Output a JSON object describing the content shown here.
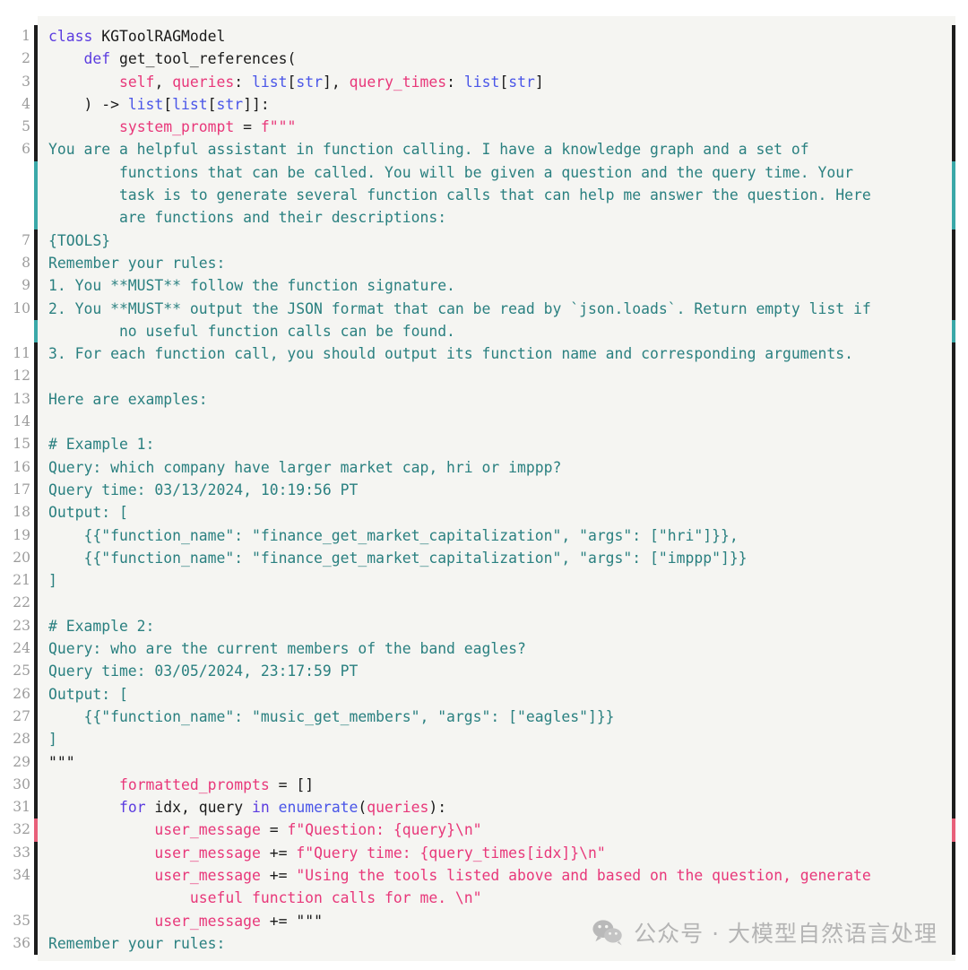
{
  "editor": {
    "language": "python",
    "background_color": "#f5f5f2",
    "gutter_color": "#ffffff",
    "line_number_color": "#9b9b9b",
    "marker_colors": {
      "dark": "#1d1d1d",
      "teal": "#3aa8a8",
      "red": "#e8607a"
    },
    "token_colors": {
      "keyword": "#5b3ce0",
      "type": "#4a56e8",
      "variable": "#e8387a",
      "string": "#e8387a",
      "docstring": "#2a8080",
      "plain": "#1a1a1a"
    },
    "line_numbers": [
      "1",
      "2",
      "3",
      "4",
      "5",
      "6",
      "",
      "",
      "",
      "7",
      "8",
      "9",
      "10",
      "",
      "11",
      "12",
      "13",
      "14",
      "15",
      "16",
      "17",
      "18",
      "19",
      "20",
      "21",
      "22",
      "23",
      "24",
      "25",
      "26",
      "27",
      "28",
      "29",
      "30",
      "31",
      "32",
      "33",
      "34",
      "",
      "35",
      "36"
    ],
    "rail": [
      "dark",
      "dark",
      "dark",
      "dark",
      "dark",
      "dark",
      "teal",
      "teal",
      "teal",
      "dark",
      "dark",
      "dark",
      "dark",
      "teal",
      "dark",
      "dark",
      "dark",
      "dark",
      "dark",
      "dark",
      "dark",
      "dark",
      "dark",
      "dark",
      "dark",
      "dark",
      "dark",
      "dark",
      "dark",
      "dark",
      "dark",
      "dark",
      "dark",
      "dark",
      "dark",
      "red",
      "dark",
      "dark"
    ],
    "lines": [
      {
        "n": "1",
        "segments": [
          {
            "t": "class",
            "c": "kw"
          },
          {
            "t": " ",
            "c": "plain"
          },
          {
            "t": "KGToolRAGModel",
            "c": "plain"
          }
        ]
      },
      {
        "n": "2",
        "segments": [
          {
            "t": "    ",
            "c": "plain"
          },
          {
            "t": "def",
            "c": "kw"
          },
          {
            "t": " ",
            "c": "plain"
          },
          {
            "t": "get_tool_references",
            "c": "plain"
          },
          {
            "t": "(",
            "c": "punc"
          }
        ]
      },
      {
        "n": "3",
        "segments": [
          {
            "t": "        ",
            "c": "plain"
          },
          {
            "t": "self",
            "c": "var"
          },
          {
            "t": ", ",
            "c": "punc"
          },
          {
            "t": "queries",
            "c": "var"
          },
          {
            "t": ": ",
            "c": "punc"
          },
          {
            "t": "list",
            "c": "typ"
          },
          {
            "t": "[",
            "c": "punc"
          },
          {
            "t": "str",
            "c": "typ"
          },
          {
            "t": "], ",
            "c": "punc"
          },
          {
            "t": "query_times",
            "c": "var"
          },
          {
            "t": ": ",
            "c": "punc"
          },
          {
            "t": "list",
            "c": "typ"
          },
          {
            "t": "[",
            "c": "punc"
          },
          {
            "t": "str",
            "c": "typ"
          },
          {
            "t": "]",
            "c": "punc"
          }
        ]
      },
      {
        "n": "4",
        "segments": [
          {
            "t": "    ) -> ",
            "c": "punc"
          },
          {
            "t": "list",
            "c": "typ"
          },
          {
            "t": "[",
            "c": "punc"
          },
          {
            "t": "list",
            "c": "typ"
          },
          {
            "t": "[",
            "c": "punc"
          },
          {
            "t": "str",
            "c": "typ"
          },
          {
            "t": "]]:",
            "c": "punc"
          }
        ]
      },
      {
        "n": "5",
        "segments": [
          {
            "t": "        ",
            "c": "plain"
          },
          {
            "t": "system_prompt",
            "c": "var"
          },
          {
            "t": " = ",
            "c": "punc"
          },
          {
            "t": "f\"\"\"",
            "c": "str"
          }
        ]
      },
      {
        "n": "6",
        "segments": [
          {
            "t": "You are a helpful assistant in function calling. I have a knowledge graph and a set of",
            "c": "doc"
          }
        ]
      },
      {
        "n": "",
        "segments": [
          {
            "t": "        functions that can be called. You will be given a question and the query time. Your",
            "c": "doc"
          }
        ]
      },
      {
        "n": "",
        "segments": [
          {
            "t": "        task is to generate several function calls that can help me answer the question. Here",
            "c": "doc"
          }
        ]
      },
      {
        "n": "",
        "segments": [
          {
            "t": "        are functions and their descriptions:",
            "c": "doc"
          }
        ]
      },
      {
        "n": "7",
        "segments": [
          {
            "t": "{TOOLS}",
            "c": "doc"
          }
        ]
      },
      {
        "n": "8",
        "segments": [
          {
            "t": "Remember your rules:",
            "c": "doc"
          }
        ]
      },
      {
        "n": "9",
        "segments": [
          {
            "t": "1. You **MUST** follow the function signature.",
            "c": "doc"
          }
        ]
      },
      {
        "n": "10",
        "segments": [
          {
            "t": "2. You **MUST** output the JSON format that can be read by `json.loads`. Return empty list if",
            "c": "doc"
          }
        ]
      },
      {
        "n": "",
        "segments": [
          {
            "t": "        no useful function calls can be found.",
            "c": "doc"
          }
        ]
      },
      {
        "n": "11",
        "segments": [
          {
            "t": "3. For each function call, you should output its function name and corresponding arguments.",
            "c": "doc"
          }
        ]
      },
      {
        "n": "12",
        "segments": [
          {
            "t": "",
            "c": "doc"
          }
        ]
      },
      {
        "n": "13",
        "segments": [
          {
            "t": "Here are examples:",
            "c": "doc"
          }
        ]
      },
      {
        "n": "14",
        "segments": [
          {
            "t": "",
            "c": "doc"
          }
        ]
      },
      {
        "n": "15",
        "segments": [
          {
            "t": "# Example 1:",
            "c": "doc"
          }
        ]
      },
      {
        "n": "16",
        "segments": [
          {
            "t": "Query: which company have larger market cap, hri or imppp?",
            "c": "doc"
          }
        ]
      },
      {
        "n": "17",
        "segments": [
          {
            "t": "Query time: 03/13/2024, 10:19:56 PT",
            "c": "doc"
          }
        ]
      },
      {
        "n": "18",
        "segments": [
          {
            "t": "Output: [",
            "c": "doc"
          }
        ]
      },
      {
        "n": "19",
        "segments": [
          {
            "t": "    {{\"function_name\": \"finance_get_market_capitalization\", \"args\": [\"hri\"]}},",
            "c": "doc"
          }
        ]
      },
      {
        "n": "20",
        "segments": [
          {
            "t": "    {{\"function_name\": \"finance_get_market_capitalization\", \"args\": [\"imppp\"]}}",
            "c": "doc"
          }
        ]
      },
      {
        "n": "21",
        "segments": [
          {
            "t": "]",
            "c": "doc"
          }
        ]
      },
      {
        "n": "22",
        "segments": [
          {
            "t": "",
            "c": "doc"
          }
        ]
      },
      {
        "n": "23",
        "segments": [
          {
            "t": "# Example 2:",
            "c": "doc"
          }
        ]
      },
      {
        "n": "24",
        "segments": [
          {
            "t": "Query: who are the current members of the band eagles?",
            "c": "doc"
          }
        ]
      },
      {
        "n": "25",
        "segments": [
          {
            "t": "Query time: 03/05/2024, 23:17:59 PT",
            "c": "doc"
          }
        ]
      },
      {
        "n": "26",
        "segments": [
          {
            "t": "Output: [",
            "c": "doc"
          }
        ]
      },
      {
        "n": "27",
        "segments": [
          {
            "t": "    {{\"function_name\": \"music_get_members\", \"args\": [\"eagles\"]}}",
            "c": "doc"
          }
        ]
      },
      {
        "n": "28",
        "segments": [
          {
            "t": "]",
            "c": "doc"
          }
        ]
      },
      {
        "n": "29",
        "segments": [
          {
            "t": "\"\"\"",
            "c": "plain"
          }
        ]
      },
      {
        "n": "30",
        "segments": [
          {
            "t": "        ",
            "c": "plain"
          },
          {
            "t": "formatted_prompts",
            "c": "var"
          },
          {
            "t": " = []",
            "c": "punc"
          }
        ]
      },
      {
        "n": "31",
        "segments": [
          {
            "t": "        ",
            "c": "plain"
          },
          {
            "t": "for",
            "c": "kw"
          },
          {
            "t": " idx, query ",
            "c": "plain"
          },
          {
            "t": "in",
            "c": "kw"
          },
          {
            "t": " ",
            "c": "plain"
          },
          {
            "t": "enumerate",
            "c": "typ"
          },
          {
            "t": "(",
            "c": "punc"
          },
          {
            "t": "queries",
            "c": "var"
          },
          {
            "t": "):",
            "c": "punc"
          }
        ]
      },
      {
        "n": "32",
        "segments": [
          {
            "t": "            ",
            "c": "plain"
          },
          {
            "t": "user_message",
            "c": "var"
          },
          {
            "t": " = ",
            "c": "punc"
          },
          {
            "t": "f\"Question: {query}\\n\"",
            "c": "str"
          }
        ]
      },
      {
        "n": "33",
        "segments": [
          {
            "t": "            ",
            "c": "plain"
          },
          {
            "t": "user_message",
            "c": "var"
          },
          {
            "t": " += ",
            "c": "punc"
          },
          {
            "t": "f\"Query time: {query_times[idx]}\\n\"",
            "c": "str"
          }
        ]
      },
      {
        "n": "34",
        "segments": [
          {
            "t": "            ",
            "c": "plain"
          },
          {
            "t": "user_message",
            "c": "var"
          },
          {
            "t": " += ",
            "c": "punc"
          },
          {
            "t": "\"Using the tools listed above and based on the question, generate",
            "c": "str"
          }
        ]
      },
      {
        "n": "",
        "segments": [
          {
            "t": "                useful function calls for me. \\n\"",
            "c": "str"
          }
        ]
      },
      {
        "n": "35",
        "segments": [
          {
            "t": "            ",
            "c": "plain"
          },
          {
            "t": "user_message",
            "c": "var"
          },
          {
            "t": " += ",
            "c": "punc"
          },
          {
            "t": "\"\"\"",
            "c": "plain"
          }
        ]
      },
      {
        "n": "36",
        "segments": [
          {
            "t": "Remember your rules:",
            "c": "doc"
          }
        ]
      }
    ]
  },
  "watermark": {
    "icon": "wechat-icon",
    "text": "公众号 · 大模型自然语言处理",
    "color": "#b4b4b4"
  }
}
